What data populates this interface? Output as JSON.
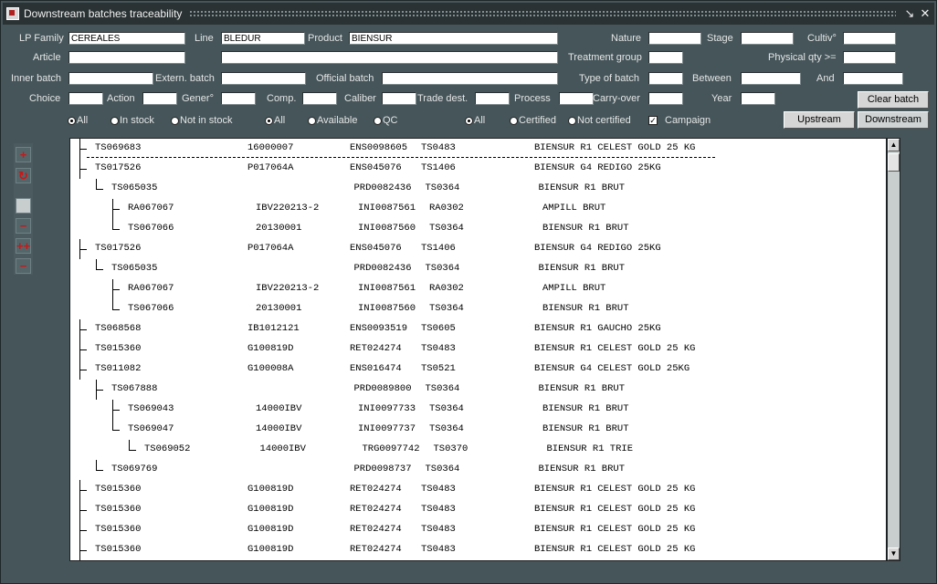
{
  "window": {
    "title": "Downstream batches traceability"
  },
  "fields": {
    "lp_family": {
      "label": "LP Family",
      "value": "CEREALES"
    },
    "line": {
      "label": "Line",
      "value": "BLEDUR"
    },
    "product": {
      "label": "Product",
      "value": "BIENSUR"
    },
    "nature": {
      "label": "Nature",
      "value": ""
    },
    "stage": {
      "label": "Stage",
      "value": ""
    },
    "cultiv": {
      "label": "Cultiv°",
      "value": ""
    },
    "article": {
      "label": "Article",
      "value": ""
    },
    "treatment_group": {
      "label": "Treatment group",
      "value": ""
    },
    "physical_qty": {
      "label": "Physical qty >=",
      "value": ""
    },
    "inner_batch": {
      "label": "Inner batch",
      "value": ""
    },
    "extern_batch": {
      "label": "Extern. batch",
      "value": ""
    },
    "official_batch": {
      "label": "Official batch",
      "value": ""
    },
    "type_of_batch": {
      "label": "Type of batch",
      "value": ""
    },
    "between": {
      "label": "Between",
      "value": ""
    },
    "and": {
      "label": "And",
      "value": ""
    },
    "choice": {
      "label": "Choice",
      "value": ""
    },
    "action": {
      "label": "Action",
      "value": ""
    },
    "gener": {
      "label": "Gener°",
      "value": ""
    },
    "comp": {
      "label": "Comp.",
      "value": ""
    },
    "caliber": {
      "label": "Caliber",
      "value": ""
    },
    "trade_dest": {
      "label": "Trade dest.",
      "value": ""
    },
    "process": {
      "label": "Process",
      "value": ""
    },
    "carry_over": {
      "label": "Carry-over",
      "value": ""
    },
    "year": {
      "label": "Year",
      "value": ""
    }
  },
  "radios": {
    "stock": [
      {
        "label": "All",
        "selected": true
      },
      {
        "label": "In stock",
        "selected": false
      },
      {
        "label": "Not in stock",
        "selected": false
      }
    ],
    "availability": [
      {
        "label": "All",
        "selected": true
      },
      {
        "label": "Available",
        "selected": false
      },
      {
        "label": "QC",
        "selected": false
      }
    ],
    "certification": [
      {
        "label": "All",
        "selected": true
      },
      {
        "label": "Certified",
        "selected": false
      },
      {
        "label": "Not certified",
        "selected": false
      }
    ]
  },
  "campaign": {
    "label": "Campaign",
    "checked": true
  },
  "buttons": {
    "clear_batch": "Clear batch",
    "upstream": "Upstream",
    "downstream": "Downstream"
  },
  "tree_rows": [
    {
      "level": 0,
      "batch": "TS069683",
      "ext": "16000007",
      "doc": "ENS0098605",
      "loc": "TS0483",
      "product": "BIENSUR R1 CELEST GOLD 25 KG",
      "selected": true
    },
    {
      "level": 0,
      "batch": "TS017526",
      "ext": "P017064A",
      "doc": "ENS045076",
      "loc": "TS1406",
      "product": "BIENSUR G4 REDIGO 25KG"
    },
    {
      "level": 1,
      "batch": "TS065035",
      "ext": "",
      "doc": "PRD0082436",
      "loc": "TS0364",
      "product": "BIENSUR R1 BRUT",
      "last": true
    },
    {
      "level": 2,
      "batch": "RA067067",
      "ext": "IBV220213-2",
      "doc": "INI0087561",
      "loc": "RA0302",
      "product": "AMPILL BRUT"
    },
    {
      "level": 2,
      "batch": "TS067066",
      "ext": "20130001",
      "doc": "INI0087560",
      "loc": "TS0364",
      "product": "BIENSUR R1 BRUT",
      "last": true
    },
    {
      "level": 0,
      "batch": "TS017526",
      "ext": "P017064A",
      "doc": "ENS045076",
      "loc": "TS1406",
      "product": "BIENSUR G4 REDIGO 25KG"
    },
    {
      "level": 1,
      "batch": "TS065035",
      "ext": "",
      "doc": "PRD0082436",
      "loc": "TS0364",
      "product": "BIENSUR R1 BRUT",
      "last": true
    },
    {
      "level": 2,
      "batch": "RA067067",
      "ext": "IBV220213-2",
      "doc": "INI0087561",
      "loc": "RA0302",
      "product": "AMPILL BRUT"
    },
    {
      "level": 2,
      "batch": "TS067066",
      "ext": "20130001",
      "doc": "INI0087560",
      "loc": "TS0364",
      "product": "BIENSUR R1 BRUT",
      "last": true
    },
    {
      "level": 0,
      "batch": "TS068568",
      "ext": "IB1012121",
      "doc": "ENS0093519",
      "loc": "TS0605",
      "product": "BIENSUR R1 GAUCHO 25KG"
    },
    {
      "level": 0,
      "batch": "TS015360",
      "ext": "G100819D",
      "doc": "RET024274",
      "loc": "TS0483",
      "product": "BIENSUR R1 CELEST GOLD 25 KG"
    },
    {
      "level": 0,
      "batch": "TS011082",
      "ext": "G100008A",
      "doc": "ENS016474",
      "loc": "TS0521",
      "product": "BIENSUR G4 CELEST GOLD 25KG"
    },
    {
      "level": 1,
      "batch": "TS067888",
      "ext": "",
      "doc": "PRD0089800",
      "loc": "TS0364",
      "product": "BIENSUR R1 BRUT"
    },
    {
      "level": 2,
      "batch": "TS069043",
      "ext": "14000IBV",
      "doc": "INI0097733",
      "loc": "TS0364",
      "product": "BIENSUR R1 BRUT"
    },
    {
      "level": 2,
      "batch": "TS069047",
      "ext": "14000IBV",
      "doc": "INI0097737",
      "loc": "TS0364",
      "product": "BIENSUR R1 BRUT",
      "last": true
    },
    {
      "level": 3,
      "batch": "TS069052",
      "ext": "14000IBV",
      "doc": "TRG0097742",
      "loc": "TS0370",
      "product": "BIENSUR R1 TRIE",
      "last": true
    },
    {
      "level": 1,
      "batch": "TS069769",
      "ext": "",
      "doc": "PRD0098737",
      "loc": "TS0364",
      "product": "BIENSUR R1 BRUT",
      "last": true
    },
    {
      "level": 0,
      "batch": "TS015360",
      "ext": "G100819D",
      "doc": "RET024274",
      "loc": "TS0483",
      "product": "BIENSUR R1 CELEST GOLD 25 KG"
    },
    {
      "level": 0,
      "batch": "TS015360",
      "ext": "G100819D",
      "doc": "RET024274",
      "loc": "TS0483",
      "product": "BIENSUR R1 CELEST GOLD 25 KG"
    },
    {
      "level": 0,
      "batch": "TS015360",
      "ext": "G100819D",
      "doc": "RET024274",
      "loc": "TS0483",
      "product": "BIENSUR R1 CELEST GOLD 25 KG"
    },
    {
      "level": 0,
      "batch": "TS015360",
      "ext": "G100819D",
      "doc": "RET024274",
      "loc": "TS0483",
      "product": "BIENSUR R1 CELEST GOLD 25 KG"
    }
  ]
}
